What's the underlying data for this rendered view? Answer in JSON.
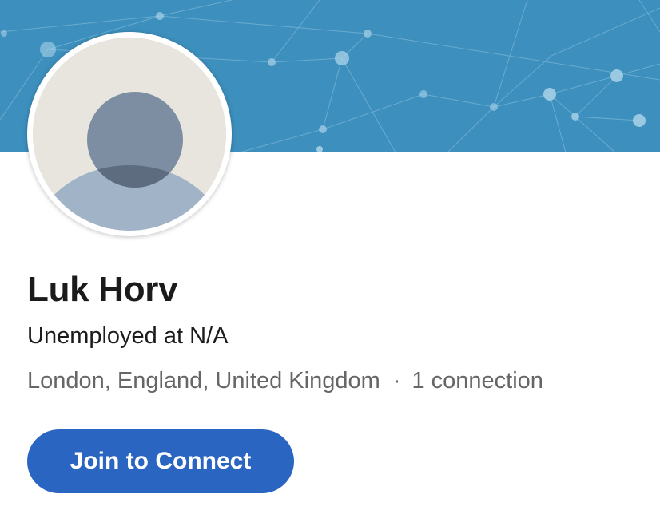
{
  "profile": {
    "name": "Luk Horv",
    "headline": "Unemployed at N/A",
    "location": "London, England, United Kingdom",
    "separator": "·",
    "connections": "1 connection",
    "avatar_icon": "default-person-avatar"
  },
  "actions": {
    "join_label": "Join to Connect"
  },
  "colors": {
    "banner": "#3d8fbd",
    "button": "#2a66c1",
    "button_text": "#ffffff",
    "meta_text": "#666666"
  }
}
